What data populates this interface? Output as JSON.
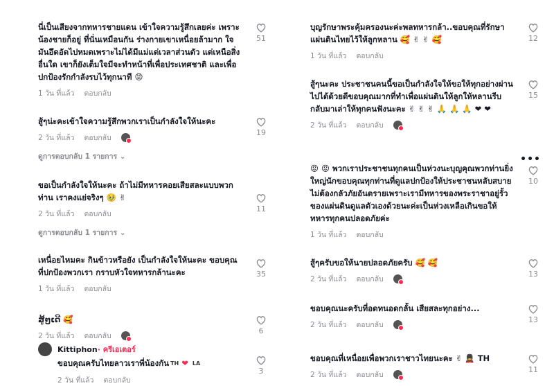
{
  "left": [
    {
      "text": "นี่เป็นเสียงจากทหารชายแดน เข้าใจความรู้สึกเลยค่ะ เพราะน้องชายก็อยู่ ที่นั่นเหมือนกัน ร่างกายเขาเหนื่อยล้ามาก ใจมันอึดอัดไปหมดเพราะไม่ได้มีแม่แต่เวลาส่วนตัว แต่เหนือสิ่งอื่นใด เขาก็ยังเต็มใจมีจะทำหน้าที่เพื่อประเทศชาติ และเพื่อปกป้องรักกำลังรบไว้ทุกนาที 😡",
      "time": "1 วัน ที่แล้ว",
      "reply": "ตอบกลับ",
      "likes": "51"
    },
    {
      "text": "สู้ๆน่ะคะเข้าใจความรู้สึกพวกเราเป็นกำลังใจให้นะคะ",
      "time": "2 วัน ที่แล้ว",
      "reply": "ตอบกลับ",
      "likes": "19",
      "view_replies": "ดูการตอบกลับ 1 รายการ ⌄"
    },
    {
      "text": "ขอเป็นกำลังใจให้นะคะ ถ้าไม่มีทหารคอยเสียสละแบบพวกท่าน เราคงแย่จริงๆ 🥹 ✌",
      "time": "2 วัน ที่แล้ว",
      "reply": "ตอบกลับ",
      "likes": "11",
      "view_replies": "ดูการตอบกลับ 1 รายการ ⌄"
    },
    {
      "text": "เหนื่อยไหมคะ กินข้าวหรือยัง เป็นกำลังใจให้นะคะ ขอบคุณที่ปกป้องพวกเรา กราบหัวใจทหารกล้านะคะ",
      "time": "1 วัน ที่แล้ว",
      "reply": "ตอบกลับ",
      "likes": "35"
    },
    {
      "text": "ສູ້ໆເດີ 🥰",
      "time": "2 วัน ที่แล้ว",
      "reply": "ตอบกลับ",
      "likes": "6"
    }
  ],
  "left_reply": {
    "name": "Kittiphon",
    "creator": " · ครีเอเตอร์",
    "text": "ขอบคุณครับไทยลาวเราพี่น้องกัน",
    "flag1": "TH",
    "flag2": "LA",
    "time": "2 วัน ที่แล้ว",
    "reply": "ตอบกลับ",
    "likes": "3"
  },
  "right": [
    {
      "text": "บุญรักษาพระคุ้มครองนะค่ะพลทหารกล้า..ขอบคุณที่รักษาแผ่นดินไทยไว้ให้ลูกหลาน 🥰 ✌ ✌ 🥰",
      "time": "1 วัน ที่แล้ว",
      "reply": "ตอบกลับ",
      "likes": "12"
    },
    {
      "text": "สู้ๆนะคะ ประชาชนคนนี้ขอเป็นกำลังใจให้ขอให้ทุกอย่างผ่านไปได้ด้วยดีขอบคุณมากที่ทำเพื่อแผ่นดินให้ลูกให้หลานรีบกลับมาเล่าให้ทุกคนฟังนะคะ ✌ ✌ ✌ 🙏 🙏 🙏 ❤ ❤",
      "time": "2 วัน ที่แล้ว",
      "reply": "ตอบกลับ",
      "likes": "15"
    },
    {
      "text": "😡 😡 พวกเราประชาชนทุกคนเป็นห่วงนะบุญคุณพวกท่านยิ่งใหญ่นักขอบคุณทุกท่านที่ดูแลปกป้องให้ประชาชนหลับสบายไม่ต้องกลัวภัยอันตรายเพราะเรามีทหารของพระราชาอยู่รั้วของแผ่นดินดูแลตัวเองด้วยนะค่ะเป็นห่วงเหลือเกินขอให้ทหารทุกคนปลอดภัยค่ะ",
      "time": "1 วัน ที่แล้ว",
      "reply": "ตอบกลับ",
      "likes": "10"
    },
    {
      "text": "สู้ๆครับขอให้นายปลอดภัยครับ 🥰 🥰",
      "time": "2 วัน ที่แล้ว",
      "reply": "ตอบกลับ",
      "likes": "13"
    },
    {
      "text": "ขอบคุณนะครับที่อดทนอดกลั้น เสียสละทุกอย่าง...",
      "time": "2 วัน ที่แล้ว",
      "reply": "ตอบกลับ",
      "likes": "13"
    },
    {
      "text": "ขอบคุณที่เหนื่อยเพื่อพวกเราชาวไทยนะคะ ✌ 💂 TH",
      "time": "2 วัน ที่แล้ว",
      "reply": "ตอบกลับ",
      "likes": "11"
    }
  ],
  "more_label": "•••",
  "colors": {
    "accent": "#fe2c55",
    "muted": "#8a8b91",
    "text": "#161823"
  },
  "icons": {
    "like": "heart-outline-icon",
    "more": "more-dots-icon"
  }
}
